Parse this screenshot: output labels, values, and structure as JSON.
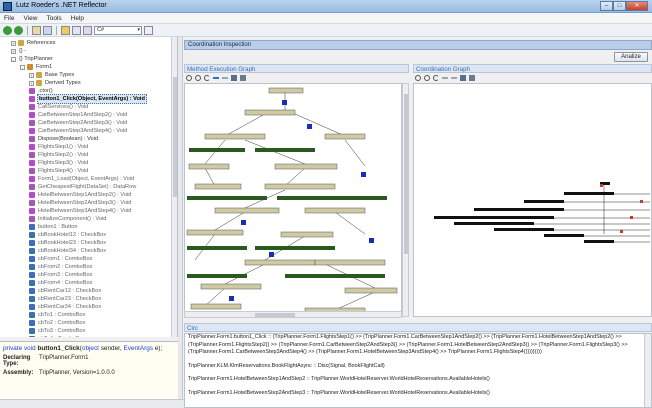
{
  "window": {
    "title": "Lutz Roeder's .NET Reflector"
  },
  "menu": [
    "File",
    "View",
    "Tools",
    "Help"
  ],
  "toolbar": {
    "language": "C#"
  },
  "tree": [
    {
      "text": "References",
      "indent": 1,
      "icon": "folder",
      "exp": "+"
    },
    {
      "text": "{} -",
      "indent": 1,
      "icon": "",
      "exp": "+"
    },
    {
      "text": "{} TripPlanner",
      "indent": 1,
      "icon": "",
      "exp": "-"
    },
    {
      "text": "Form1",
      "indent": 2,
      "icon": "class",
      "exp": "-"
    },
    {
      "text": "Base Types",
      "indent": 3,
      "icon": "folder",
      "exp": "+"
    },
    {
      "text": "Derived Types",
      "indent": 3,
      "icon": "folder",
      "exp": "+"
    },
    {
      "text": ".ctor()",
      "indent": 3,
      "icon": "method",
      "exp": ""
    },
    {
      "text": "button1_Click(Object, EventArgs) : Void",
      "indent": 3,
      "icon": "method",
      "exp": "",
      "selected": true
    },
    {
      "text": "CallServices() : Void",
      "indent": 3,
      "icon": "method",
      "exp": "",
      "dim": true
    },
    {
      "text": "CarBetweenStep1AndStep2() : Void",
      "indent": 3,
      "icon": "method",
      "exp": "",
      "dim": true
    },
    {
      "text": "CarBetweenStep2AndStep3() : Void",
      "indent": 3,
      "icon": "method",
      "exp": "",
      "dim": true
    },
    {
      "text": "CarBetweenStep3AndStep4() : Void",
      "indent": 3,
      "icon": "method",
      "exp": "",
      "dim": true
    },
    {
      "text": "Dispose(Boolean) : Void",
      "indent": 3,
      "icon": "method",
      "exp": ""
    },
    {
      "text": "FlightsStep1() : Void",
      "indent": 3,
      "icon": "method",
      "exp": "",
      "dim": true
    },
    {
      "text": "FlightsStep2() : Void",
      "indent": 3,
      "icon": "method",
      "exp": "",
      "dim": true
    },
    {
      "text": "FlightsStep3() : Void",
      "indent": 3,
      "icon": "method",
      "exp": "",
      "dim": true
    },
    {
      "text": "FlightsStep4() : Void",
      "indent": 3,
      "icon": "method",
      "exp": "",
      "dim": true
    },
    {
      "text": "Form1_Load(Object, EventArgs) : Void",
      "indent": 3,
      "icon": "method",
      "exp": "",
      "dim": true
    },
    {
      "text": "GetCheapestFlight(DataSet) : DataRow",
      "indent": 3,
      "icon": "method",
      "exp": "",
      "dim": true
    },
    {
      "text": "HotelBetweenStep1AndStep2() : Void",
      "indent": 3,
      "icon": "method",
      "exp": "",
      "dim": true
    },
    {
      "text": "HotelBetweenStep2AndStep3() : Void",
      "indent": 3,
      "icon": "method",
      "exp": "",
      "dim": true
    },
    {
      "text": "HotelBetweenStep3AndStep4() : Void",
      "indent": 3,
      "icon": "method",
      "exp": "",
      "dim": true
    },
    {
      "text": "InitializeComponent() : Void",
      "indent": 3,
      "icon": "method",
      "exp": "",
      "dim": true
    },
    {
      "text": "button1 : Button",
      "indent": 3,
      "icon": "field",
      "exp": "",
      "dim": true
    },
    {
      "text": "cbBookHotel12 : CheckBox",
      "indent": 3,
      "icon": "field",
      "exp": "",
      "dim": true
    },
    {
      "text": "cbBookHotel23 : CheckBox",
      "indent": 3,
      "icon": "field",
      "exp": "",
      "dim": true
    },
    {
      "text": "cbBookHotel34 : CheckBox",
      "indent": 3,
      "icon": "field",
      "exp": "",
      "dim": true
    },
    {
      "text": "cbFrom1 : ComboBox",
      "indent": 3,
      "icon": "field",
      "exp": "",
      "dim": true
    },
    {
      "text": "cbFrom2 : ComboBox",
      "indent": 3,
      "icon": "field",
      "exp": "",
      "dim": true
    },
    {
      "text": "cbFrom3 : ComboBox",
      "indent": 3,
      "icon": "field",
      "exp": "",
      "dim": true
    },
    {
      "text": "cbFrom4 : ComboBox",
      "indent": 3,
      "icon": "field",
      "exp": "",
      "dim": true
    },
    {
      "text": "cbRentCar12 : CheckBox",
      "indent": 3,
      "icon": "field",
      "exp": "",
      "dim": true
    },
    {
      "text": "cbRentCar23 : CheckBox",
      "indent": 3,
      "icon": "field",
      "exp": "",
      "dim": true
    },
    {
      "text": "cbRentCar34 : CheckBox",
      "indent": 3,
      "icon": "field",
      "exp": "",
      "dim": true
    },
    {
      "text": "cbTo1 : ComboBox",
      "indent": 3,
      "icon": "field",
      "exp": "",
      "dim": true
    },
    {
      "text": "cbTo2 : ComboBox",
      "indent": 3,
      "icon": "field",
      "exp": "",
      "dim": true
    },
    {
      "text": "cbTo3 : ComboBox",
      "indent": 3,
      "icon": "field",
      "exp": "",
      "dim": true
    },
    {
      "text": "cbTo4 : ComboBox",
      "indent": 3,
      "icon": "field",
      "exp": "",
      "dim": true
    }
  ],
  "info": {
    "kw_private": "private",
    "kw_void": "void",
    "method": "button1_Click",
    "params_1": "(",
    "t_object": "object",
    "p_sender": " sender, ",
    "t_eventargs": "EventArgs",
    "p_e": " e);",
    "declaring_label": "Declaring Type:",
    "declaring_value": "TripPlanner.Form1",
    "assembly_label": "Assembly:",
    "assembly_value": "TripPlanner, Version=1.0.0.0"
  },
  "inspection": {
    "header": "Coordination Inspection",
    "analyze": "Analize",
    "method_graph_title": "Method Execution Graph",
    "coord_graph_title": "Coordination Graph",
    "circ_title": "Circ",
    "circ_lines": [
      "TripPlanner.Form1.button1_Click :: (TripPlanner.Form1.FlightsStep1() >> (TripPlanner.Form1.CarBetweenStep1AndStep2() >> (TripPlanner.Form1.HotelBetweenStep1AndStep2() >>",
      "(TripPlanner.Form1.FlightsStep2() >> (TripPlanner.Form1.CarBetweenStep2AndStep3() >> (TripPlanner.Form1.HotelBetweenStep2AndStep3() >> (TripPlanner.Form1.FlightsStep3() >>",
      "(TripPlanner.Form1.CarBetweenStep3AndStep4() >> (TripPlanner.Form1.HotelBetweenStep3AndStep4() >> TripPlanner.Form1.FlightsStep4()))))))))",
      "",
      "TripPlanner.KLM.KlmReservations.BookFlightAsync :: Disc(Signal, BookFlightCall)",
      "",
      "TripPlanner.Form1.HotelBetweenStep1AndStep2 :: TripPlanner.WorldHotelReserver.WorldHotelReservations.AvailableHotels()",
      "",
      "TripPlanner.Form1.HotelBetweenStep2AndStep3 :: TripPlanner.WorldHotelReserver.WorldHotelReservations.AvailableHotels()"
    ]
  }
}
